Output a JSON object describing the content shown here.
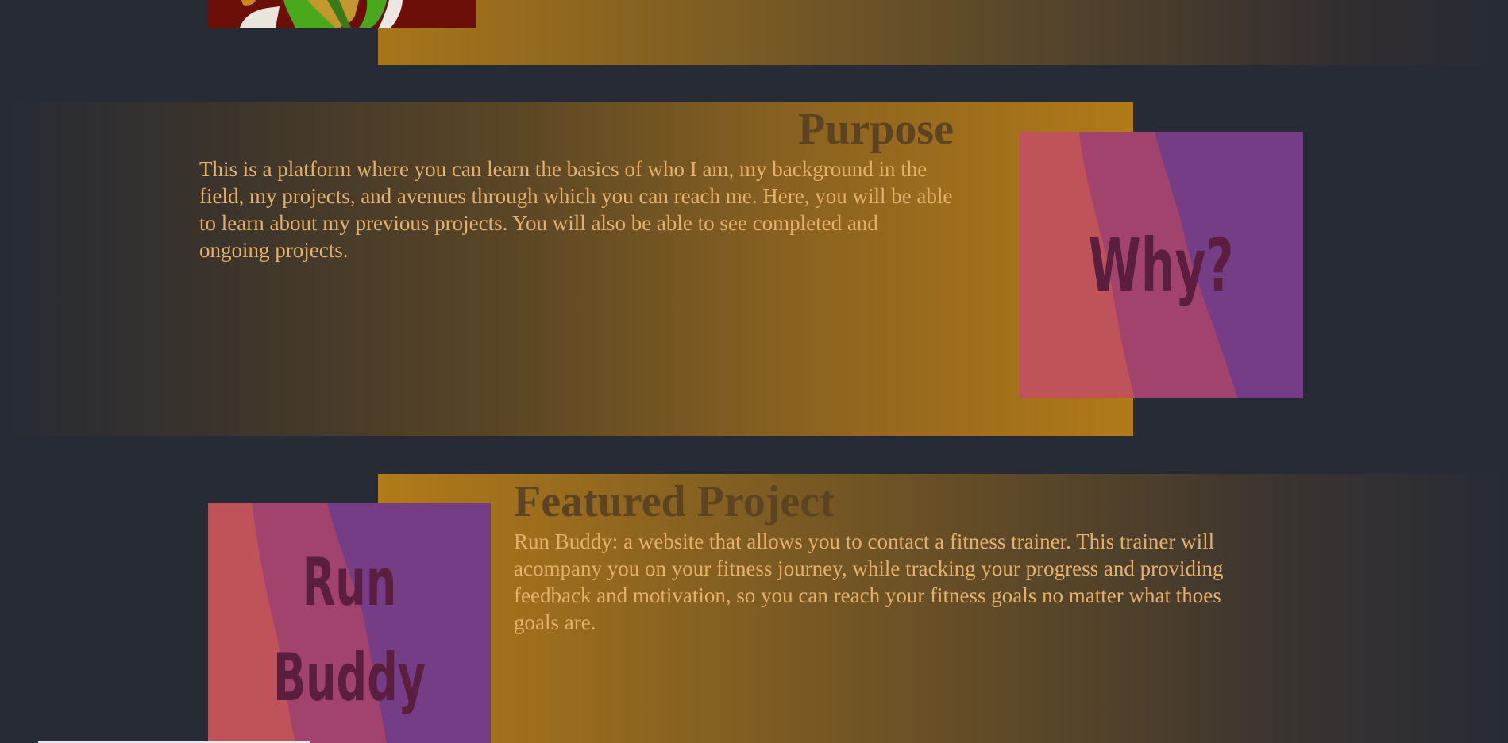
{
  "purpose": {
    "title": "Purpose",
    "text": "This is a platform where you can learn the basics of who I am, my background in the field, my projects, and avenues through which you can reach me. Here, you will be able to learn about my previous projects. You will also be able to see completed and ongoing projects.",
    "image_label": "Why?"
  },
  "featured": {
    "title": "Featured Project",
    "text": "Run Buddy: a website that allows you to contact a fitness trainer. This trainer will acompany you on your fitness journey, while tracking your progress and providing feedback and motivation, so you can reach your fitness goals no matter what thoes goals are.",
    "image_label_line1": "Run",
    "image_label_line2": "Buddy"
  },
  "colors": {
    "page_background": "#262b35",
    "accent_gold": "#b27a18",
    "heading_brown": "#5c4423",
    "body_text": "#e4b06b",
    "art_red": "#c0525a",
    "art_magenta": "#a2436e",
    "art_purple": "#743d85",
    "art_text": "#5a1f3e"
  }
}
